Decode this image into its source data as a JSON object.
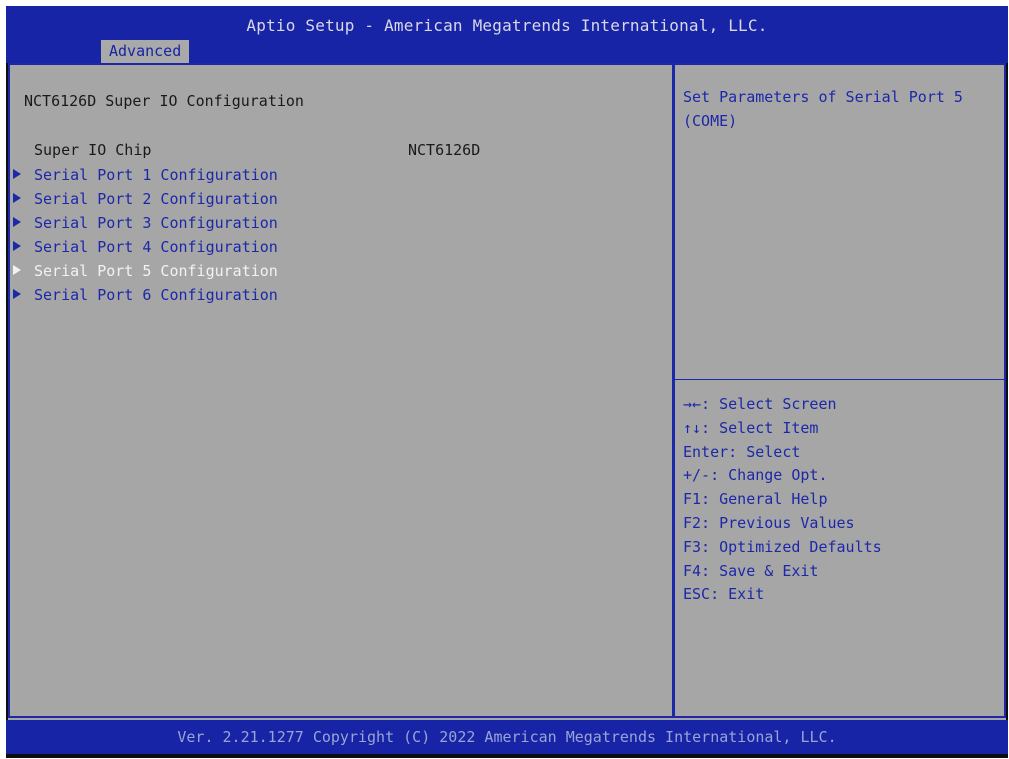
{
  "header": {
    "title": "Aptio Setup - American Megatrends International, LLC.",
    "active_tab": "Advanced"
  },
  "page": {
    "section_title": "NCT6126D Super IO Configuration",
    "chip_label": "Super IO Chip",
    "chip_value": "NCT6126D"
  },
  "menu": {
    "items": [
      {
        "label": "Serial Port 1 Configuration"
      },
      {
        "label": "Serial Port 2 Configuration"
      },
      {
        "label": "Serial Port 3 Configuration"
      },
      {
        "label": "Serial Port 4 Configuration"
      },
      {
        "label": "Serial Port 5 Configuration"
      },
      {
        "label": "Serial Port 6 Configuration"
      }
    ],
    "selected_index": 4
  },
  "help": {
    "text": "Set Parameters of Serial Port 5 (COME)"
  },
  "keys": [
    "→←: Select Screen",
    "↑↓: Select Item",
    "Enter: Select",
    "+/-: Change Opt.",
    "F1: General Help",
    "F2: Previous Values",
    "F3: Optimized Defaults",
    "F4: Save & Exit",
    "ESC: Exit"
  ],
  "footer": {
    "text": "Ver. 2.21.1277 Copyright (C) 2022 American Megatrends International, LLC."
  },
  "colors": {
    "bar_blue": "#1824a6",
    "pane_gray": "#a6a6a6",
    "item_blue": "#1c28a8",
    "selected_white": "#f2f2f2"
  }
}
